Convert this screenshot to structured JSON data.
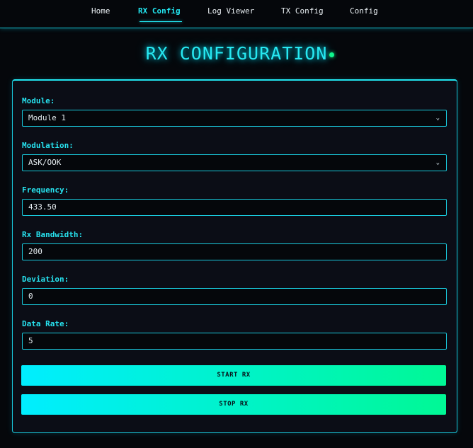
{
  "nav": {
    "items": [
      {
        "label": "Home",
        "active": false
      },
      {
        "label": "RX Config",
        "active": true
      },
      {
        "label": "Log Viewer",
        "active": false
      },
      {
        "label": "TX Config",
        "active": false
      },
      {
        "label": "Config",
        "active": false
      }
    ]
  },
  "page": {
    "title": "RX CONFIGURATION"
  },
  "form": {
    "module": {
      "label": "Module:",
      "value": "Module 1"
    },
    "modulation": {
      "label": "Modulation:",
      "value": "ASK/OOK"
    },
    "frequency": {
      "label": "Frequency:",
      "value": "433.50"
    },
    "rx_bandwidth": {
      "label": "Rx Bandwidth:",
      "value": "200"
    },
    "deviation": {
      "label": "Deviation:",
      "value": "0"
    },
    "data_rate": {
      "label": "Data Rate:",
      "value": "5"
    }
  },
  "actions": {
    "start_label": "START RX",
    "stop_label": "STOP RX"
  },
  "icons": {
    "select_chevron": "chevron-down-icon",
    "status_dot": "status-dot-icon"
  },
  "colors": {
    "accent": "#22e6f0",
    "status": "#0ff78e",
    "background": "#05070b",
    "panel": "#0b0d16"
  }
}
